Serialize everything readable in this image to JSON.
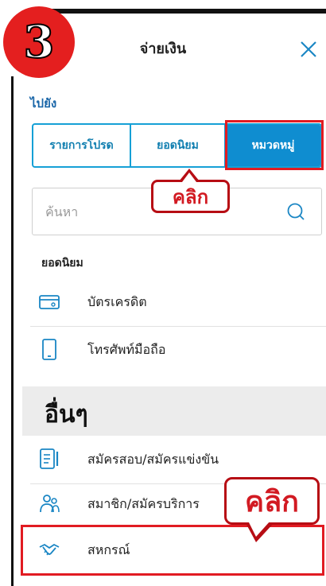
{
  "step": {
    "number": "3"
  },
  "header": {
    "title": "จ่ายเงิน"
  },
  "goto": {
    "label": "ไปยัง"
  },
  "tabs": [
    {
      "label": "รายการโปรด"
    },
    {
      "label": "ยอดนิยม"
    },
    {
      "label": "หมวดหมู่"
    }
  ],
  "search": {
    "placeholder": "ค้นหา"
  },
  "callouts": {
    "first": "คลิก",
    "second": "คลิก"
  },
  "popular": {
    "heading": "ยอดนิยม",
    "items": [
      {
        "label": "บัตรเครดิต",
        "icon": "credit-card-icon"
      },
      {
        "label": "โทรศัพท์มือถือ",
        "icon": "mobile-phone-icon"
      }
    ]
  },
  "others": {
    "heading": "อื่นๆ",
    "items": [
      {
        "label": "สมัครสอบ/สมัครแข่งขัน",
        "icon": "exam-form-icon"
      },
      {
        "label": "สมาชิก/สมัครบริการ",
        "icon": "members-icon"
      },
      {
        "label": "สหกรณ์",
        "icon": "handshake-icon"
      }
    ]
  },
  "colors": {
    "accent": "#0f8dd0",
    "highlight": "#e11b22",
    "step_badge": "#e41f1f"
  }
}
